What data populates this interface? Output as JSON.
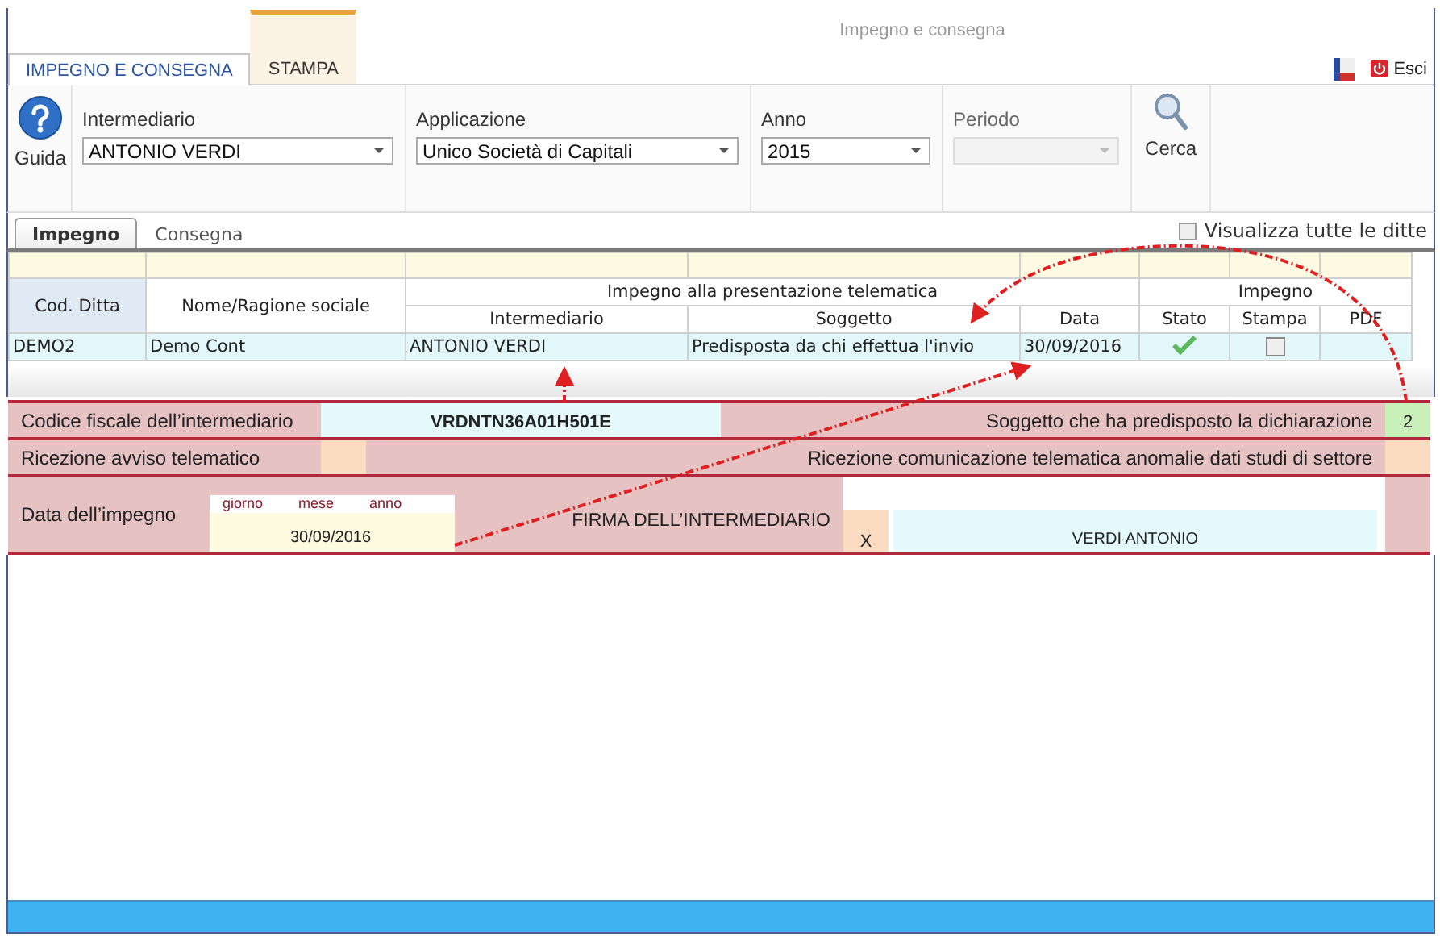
{
  "window": {
    "title": "Impegno e consegna"
  },
  "ribbon": {
    "tabs": [
      {
        "label": "IMPEGNO E CONSEGNA",
        "selected": true,
        "kind": "normal"
      },
      {
        "label": "STAMPA",
        "selected": false,
        "kind": "contextual"
      }
    ],
    "exit": "Esci"
  },
  "toolbar": {
    "help": "Guida",
    "fields": [
      {
        "label": "Intermediario",
        "value": "ANTONIO VERDI",
        "disabled": false
      },
      {
        "label": "Applicazione",
        "value": "Unico Società di Capitali",
        "disabled": false
      },
      {
        "label": "Anno",
        "value": "2015",
        "disabled": false
      },
      {
        "label": "Periodo",
        "disabled": true
      }
    ],
    "search": "Cerca"
  },
  "subtabs": [
    {
      "label": "Impegno",
      "selected": true
    },
    {
      "label": "Consegna",
      "selected": false
    }
  ],
  "show_all": {
    "label": "Visualizza tutte le ditte",
    "checked": false
  },
  "table": {
    "header": [
      {
        "label": "Cod. Ditta"
      },
      {
        "label": "Nome/Ragione sociale"
      },
      {
        "label": "Impegno alla presentazione telematica",
        "columns": [
          "Intermediario",
          "Soggetto",
          "Data"
        ]
      },
      {
        "label": "Impegno",
        "columns": [
          "Stato",
          "Stampa",
          "PDF"
        ]
      }
    ],
    "rows": [
      {
        "cod": "DEMO2",
        "nome": "Demo Cont",
        "intermediario": "ANTONIO VERDI",
        "soggetto": "Predisposta da chi effettua l'invio",
        "data": "30/09/2016",
        "stato_ok": true,
        "stampa": false,
        "selected": true
      }
    ]
  },
  "form": {
    "codice_label": "Codice fiscale dell’intermediario",
    "codice_value": "VRDNTN36A01H501E",
    "soggetto_label": "Soggetto che ha predisposto la dichiarazione",
    "soggetto_value": "2",
    "avviso_label": "Ricezione avviso telematico",
    "anomalie_label": "Ricezione comunicazione telematica anomalie dati studi di settore",
    "data_label": "Data dell’impegno",
    "date_parts": [
      "giorno",
      "mese",
      "anno"
    ],
    "data_value": "30/09/2016",
    "firma_label": "FIRMA DELL’INTERMEDIARIO",
    "firma_mark": "X",
    "firma_name": "VERDI ANTONIO"
  }
}
